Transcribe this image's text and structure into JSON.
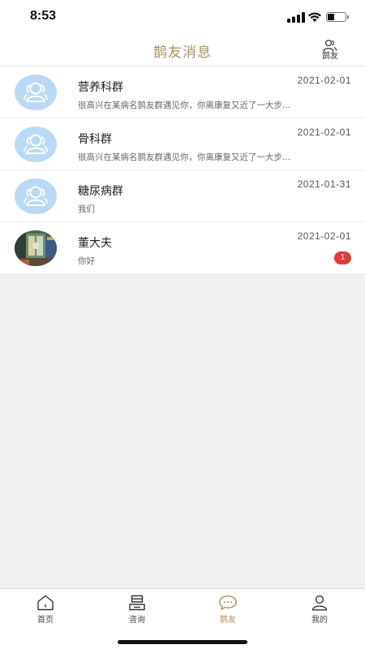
{
  "status_bar": {
    "time": "8:53",
    "battery_level": 0.4
  },
  "header": {
    "title": "鹊友消息",
    "friends_button_label": "鹊友"
  },
  "conversations": [
    {
      "name": "营养科群",
      "preview": "很高兴在某病名鹊友群遇见你，你离康复又近了一大步...",
      "time": "2021-02-01",
      "avatar": "group-icon",
      "unread": null
    },
    {
      "name": "骨科群",
      "preview": "很高兴在某病名鹊友群遇见你，你离康复又近了一大步...",
      "time": "2021-02-01",
      "avatar": "group-icon",
      "unread": null
    },
    {
      "name": "糖尿病群",
      "preview": "我们",
      "time": "2021-01-31",
      "avatar": "group-icon",
      "unread": null
    },
    {
      "name": "董大夫",
      "preview": "你好",
      "time": "2021-02-01",
      "avatar": "user-photo",
      "unread": "1"
    }
  ],
  "tabs": [
    {
      "label": "首页",
      "icon": "home-icon",
      "active": false
    },
    {
      "label": "咨询",
      "icon": "consult-icon",
      "active": false
    },
    {
      "label": "鹊友",
      "icon": "chat-bubble-icon",
      "active": true
    },
    {
      "label": "我的",
      "icon": "person-icon",
      "active": false
    }
  ],
  "colors": {
    "accent": "#b08d5e",
    "badge": "#e53935",
    "avatar_bg": "#b9daf7"
  }
}
